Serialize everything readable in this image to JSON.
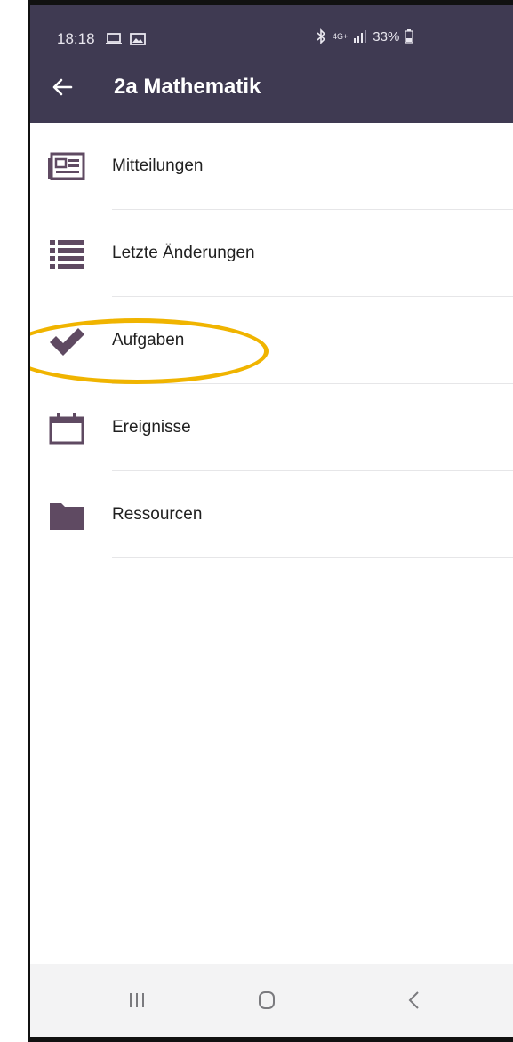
{
  "status_bar": {
    "time": "18:18",
    "battery": "33%",
    "network": "4G+"
  },
  "header": {
    "title": "2a Mathematik"
  },
  "menu": {
    "items": [
      {
        "label": "Mitteilungen",
        "icon": "newspaper-icon"
      },
      {
        "label": "Letzte Änderungen",
        "icon": "list-icon"
      },
      {
        "label": "Aufgaben",
        "icon": "checkmark-icon"
      },
      {
        "label": "Ereignisse",
        "icon": "calendar-icon"
      },
      {
        "label": "Ressourcen",
        "icon": "folder-icon"
      }
    ]
  },
  "colors": {
    "header_bg": "#3f3a52",
    "icon": "#5f4a62",
    "highlight": "#f0b400"
  }
}
